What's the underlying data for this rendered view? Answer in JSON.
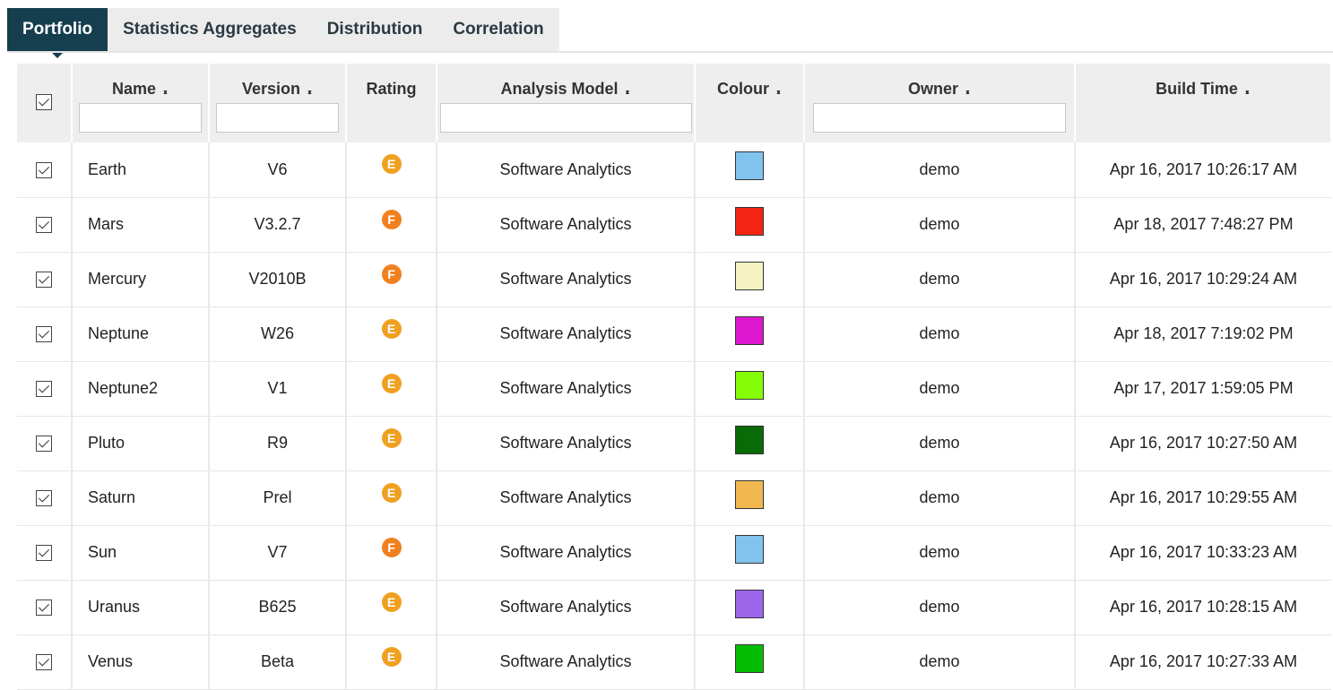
{
  "tabs": [
    {
      "label": "Portfolio",
      "active": true
    },
    {
      "label": "Statistics Aggregates",
      "active": false
    },
    {
      "label": "Distribution",
      "active": false
    },
    {
      "label": "Correlation",
      "active": false
    }
  ],
  "table": {
    "columns": {
      "name": "Name",
      "version": "Version",
      "rating": "Rating",
      "model": "Analysis Model",
      "colour": "Colour",
      "owner": "Owner",
      "build": "Build Time"
    },
    "sort_icon": "sort-icon",
    "filters": {
      "name": "",
      "version": "",
      "model": "",
      "owner": ""
    },
    "rating_colors": {
      "E": "#f0a020",
      "F": "#f08020"
    },
    "rows": [
      {
        "checked": true,
        "name": "Earth",
        "version": "V6",
        "rating": "E",
        "model": "Software Analytics",
        "colour": "#82c3ee",
        "owner": "demo",
        "build": "Apr 16, 2017 10:26:17 AM"
      },
      {
        "checked": true,
        "name": "Mars",
        "version": "V3.2.7",
        "rating": "F",
        "model": "Software Analytics",
        "colour": "#f32413",
        "owner": "demo",
        "build": "Apr 18, 2017 7:48:27 PM"
      },
      {
        "checked": true,
        "name": "Mercury",
        "version": "V2010B",
        "rating": "F",
        "model": "Software Analytics",
        "colour": "#f5f2c4",
        "owner": "demo",
        "build": "Apr 16, 2017 10:29:24 AM"
      },
      {
        "checked": true,
        "name": "Neptune",
        "version": "W26",
        "rating": "E",
        "model": "Software Analytics",
        "colour": "#dd16cf",
        "owner": "demo",
        "build": "Apr 18, 2017 7:19:02 PM"
      },
      {
        "checked": true,
        "name": "Neptune2",
        "version": "V1",
        "rating": "E",
        "model": "Software Analytics",
        "colour": "#84fd06",
        "owner": "demo",
        "build": "Apr 17, 2017 1:59:05 PM"
      },
      {
        "checked": true,
        "name": "Pluto",
        "version": "R9",
        "rating": "E",
        "model": "Software Analytics",
        "colour": "#086b06",
        "owner": "demo",
        "build": "Apr 16, 2017 10:27:50 AM"
      },
      {
        "checked": true,
        "name": "Saturn",
        "version": "Prel",
        "rating": "E",
        "model": "Software Analytics",
        "colour": "#f2b850",
        "owner": "demo",
        "build": "Apr 16, 2017 10:29:55 AM"
      },
      {
        "checked": true,
        "name": "Sun",
        "version": "V7",
        "rating": "F",
        "model": "Software Analytics",
        "colour": "#82c3ee",
        "owner": "demo",
        "build": "Apr 16, 2017 10:33:23 AM"
      },
      {
        "checked": true,
        "name": "Uranus",
        "version": "B625",
        "rating": "E",
        "model": "Software Analytics",
        "colour": "#9c66ea",
        "owner": "demo",
        "build": "Apr 16, 2017 10:28:15 AM"
      },
      {
        "checked": true,
        "name": "Venus",
        "version": "Beta",
        "rating": "E",
        "model": "Software Analytics",
        "colour": "#06bd06",
        "owner": "demo",
        "build": "Apr 16, 2017 10:27:33 AM"
      }
    ]
  }
}
